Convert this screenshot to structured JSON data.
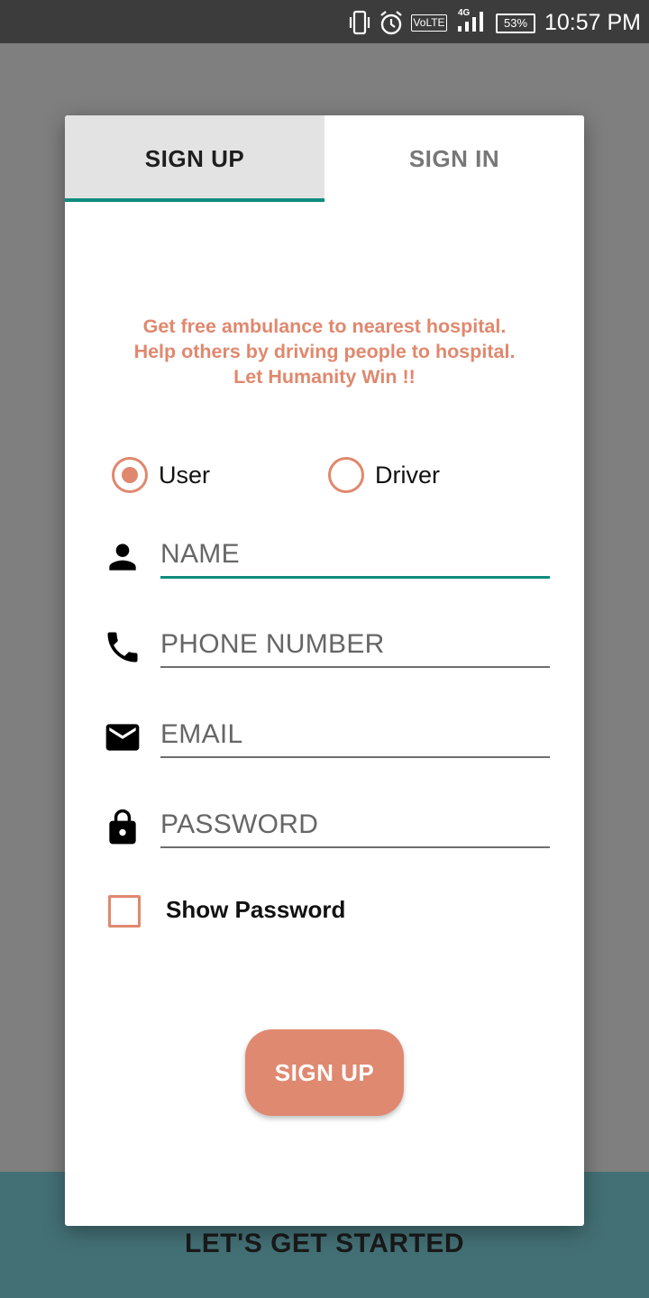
{
  "status_bar": {
    "network_label": "VoLTE",
    "signal_label": "4G",
    "battery": "53%",
    "time": "10:57 PM",
    "icons": [
      "vibrate-icon",
      "alarm-icon",
      "volte-icon",
      "signal-icon",
      "battery-icon"
    ]
  },
  "tabs": [
    {
      "label": "SIGN UP",
      "selected": true
    },
    {
      "label": "SIGN IN",
      "selected": false
    }
  ],
  "tagline": [
    "Get free ambulance to nearest hospital.",
    "Help others by driving people to hospital.",
    "Let Humanity Win !!"
  ],
  "role": {
    "options": [
      {
        "label": "User",
        "selected": true
      },
      {
        "label": "Driver",
        "selected": false
      }
    ]
  },
  "fields": {
    "name": {
      "placeholder": "NAME",
      "icon": "person-icon",
      "focused": true
    },
    "phone": {
      "placeholder": "PHONE NUMBER",
      "icon": "phone-icon"
    },
    "email": {
      "placeholder": "EMAIL",
      "icon": "email-icon"
    },
    "password": {
      "placeholder": "PASSWORD",
      "icon": "lock-icon"
    }
  },
  "show_password": {
    "label": "Show Password",
    "checked": false
  },
  "submit": {
    "label": "SIGN UP"
  },
  "banner": {
    "text": "LET'S GET STARTED"
  },
  "colors": {
    "accent": "#e0886e",
    "teal": "#0e8c7f",
    "banner": "#437075",
    "overlay": "#7f7f7f"
  }
}
